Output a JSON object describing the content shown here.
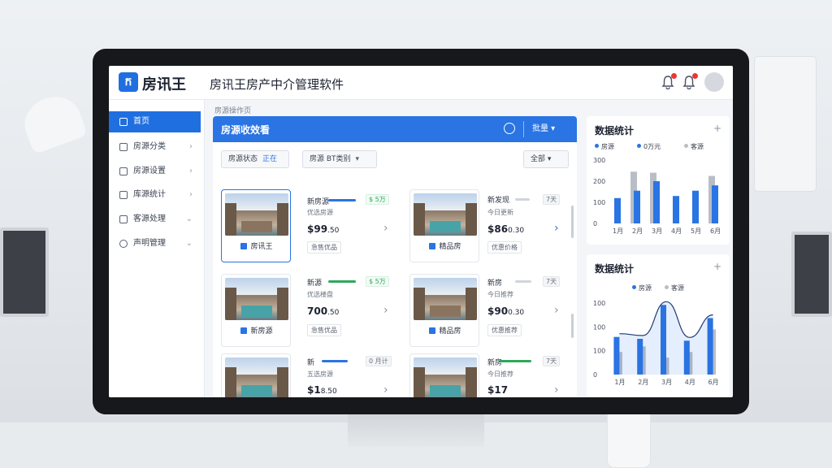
{
  "app": {
    "logo_mark": "ក",
    "logo_text": "房讯王",
    "title": "房讯王房产中介管理软件",
    "breadcrumb": "房源操作页"
  },
  "sidebar": {
    "items": [
      {
        "label": "首页",
        "active": true,
        "icon": "home-icon"
      },
      {
        "label": "房源分类",
        "active": false,
        "icon": "grid-icon"
      },
      {
        "label": "房源设置",
        "active": false,
        "icon": "building-icon"
      },
      {
        "label": "库源统计",
        "active": false,
        "icon": "folder-icon"
      },
      {
        "label": "客源处理",
        "active": false,
        "icon": "users-icon"
      },
      {
        "label": "声明管理",
        "active": false,
        "icon": "gear-icon"
      }
    ]
  },
  "listing": {
    "title": "房源收效看",
    "head_button": "批量 ▾",
    "filters": [
      {
        "label": "房源状态",
        "tag": "正在"
      },
      {
        "label": "房源  BT类别",
        "tag": "▾"
      },
      {
        "label": "全部 ▾",
        "tag": ""
      }
    ],
    "cards": [
      {
        "label": "房讯王",
        "name": "新房源",
        "sub": "优选房源",
        "price": "$99",
        "price_sub": ".50",
        "badge": "$ 5万",
        "chip": "急售优品"
      },
      {
        "label": "精品房",
        "name": "新发现",
        "sub": "今日更新",
        "price": "$86",
        "price_sub": "0.30",
        "badge": "7天",
        "chip": "优惠价格"
      },
      {
        "label": "新房源",
        "name": "新源",
        "sub": "优选楼盘",
        "price": "700",
        "price_sub": ".50",
        "badge": "$ 5万",
        "chip": "急售优品"
      },
      {
        "label": "精品房",
        "name": "新房",
        "sub": "今日推荐",
        "price": "$90",
        "price_sub": "0.30",
        "badge": "7天",
        "chip": "优惠推荐"
      },
      {
        "label": "新源",
        "name": "新",
        "sub": "五选房源",
        "price": "$1",
        "price_sub": "8.50",
        "badge": "0 月计",
        "chip": "急售优品"
      },
      {
        "label": "精品",
        "name": "新房",
        "sub": "今日推荐",
        "price": "$17",
        "price_sub": "",
        "badge": "7天",
        "chip": "优惠推荐"
      }
    ]
  },
  "stats_top": {
    "title": "数据统计",
    "legend": [
      "房源",
      "0万元",
      "客源"
    ],
    "colors": {
      "blue": "#2a74e3",
      "grey": "#b9bec6"
    }
  },
  "stats_bottom": {
    "title": "数据统计",
    "legend": [
      "房源",
      "客源"
    ]
  },
  "chart_data": [
    {
      "type": "bar",
      "categories": [
        "1月",
        "2月",
        "3月",
        "4月",
        "5月",
        "6月"
      ],
      "series": [
        {
          "name": "房源",
          "values": [
            120,
            155,
            200,
            130,
            155,
            180
          ]
        },
        {
          "name": "客源",
          "values": [
            0,
            245,
            240,
            0,
            0,
            225
          ]
        }
      ],
      "yticks": [
        "300",
        "200",
        "100",
        "0"
      ],
      "ylim": [
        0,
        300
      ]
    },
    {
      "type": "bar",
      "categories": [
        "1月",
        "2月",
        "3月",
        "4月",
        "6月"
      ],
      "series": [
        {
          "name": "房源",
          "values": [
            100,
            95,
            185,
            90,
            150
          ]
        },
        {
          "name": "客源",
          "values": [
            60,
            75,
            45,
            60,
            120
          ]
        }
      ],
      "yticks": [
        "100",
        "100",
        "100",
        "0"
      ],
      "ylim": [
        0,
        190
      ]
    }
  ]
}
